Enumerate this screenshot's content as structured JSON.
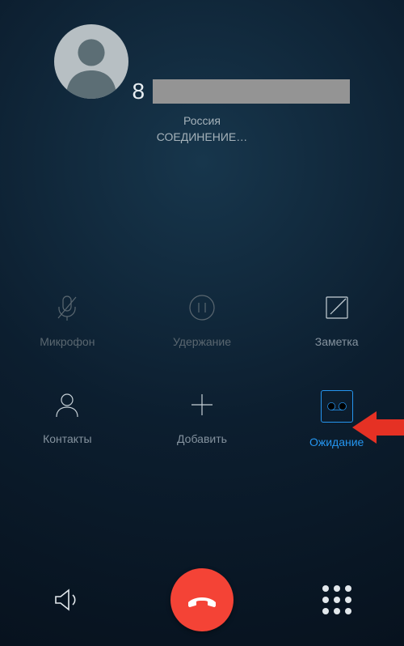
{
  "contact": {
    "number_prefix": "8",
    "country": "Россия",
    "call_status": "СОЕДИНЕНИЕ…"
  },
  "actions": {
    "mic": {
      "label": "Микрофон",
      "enabled": false
    },
    "hold": {
      "label": "Удержание",
      "enabled": false
    },
    "note": {
      "label": "Заметка",
      "enabled": true
    },
    "contacts": {
      "label": "Контакты",
      "enabled": true
    },
    "add": {
      "label": "Добавить",
      "enabled": true
    },
    "waiting": {
      "label": "Ожидание",
      "enabled": true,
      "active": true
    }
  },
  "annotation": {
    "highlighted_action": "waiting"
  }
}
